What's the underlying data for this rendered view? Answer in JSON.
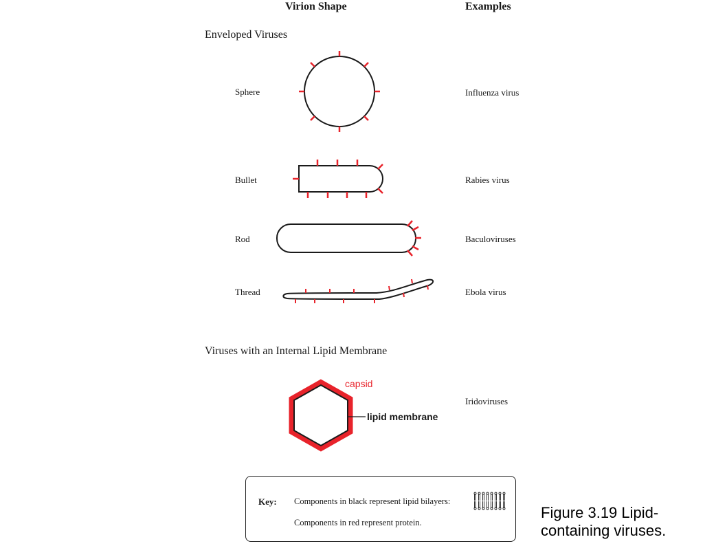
{
  "headers": {
    "shape": "Virion Shape",
    "examples": "Examples"
  },
  "enveloped": {
    "title": "Enveloped Viruses",
    "rows": [
      {
        "shape": "Sphere",
        "example": "Influenza virus"
      },
      {
        "shape": "Bullet",
        "example": "Rabies virus"
      },
      {
        "shape": "Rod",
        "example": "Baculoviruses"
      },
      {
        "shape": "Thread",
        "example": "Ebola virus"
      }
    ]
  },
  "internal": {
    "title": "Viruses with an Internal Lipid Membrane",
    "example": "Iridoviruses",
    "capsid_label": "capsid",
    "membrane_label": "lipid membrane"
  },
  "key": {
    "label": "Key:",
    "black_text": "Components in black represent lipid bilayers:",
    "red_text": "Components in red represent protein."
  },
  "caption": "Figure 3.19 Lipid-containing viruses.",
  "colors": {
    "protein": "#e8232b",
    "lipid": "#1a1a1a"
  }
}
